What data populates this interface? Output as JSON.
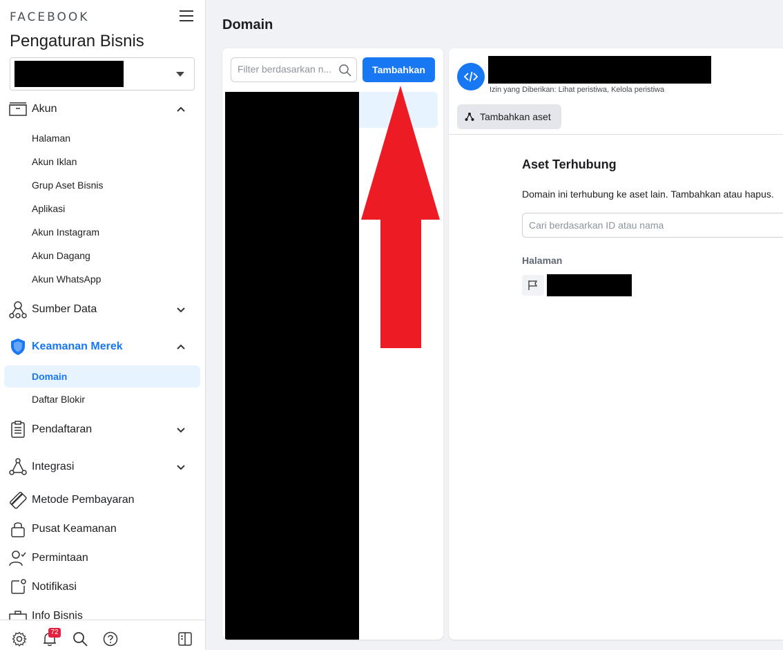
{
  "sidebar": {
    "brand": "FACEBOOK",
    "title": "Pengaturan Bisnis",
    "groups": {
      "akun": "Akun",
      "sumber_data": "Sumber Data",
      "keamanan": "Keamanan Merek",
      "pendaftaran": "Pendaftaran",
      "integrasi": "Integrasi",
      "pembayaran": "Metode Pembayaran",
      "pusat": "Pusat Keamanan",
      "permintaan": "Permintaan",
      "notifikasi": "Notifikasi",
      "info": "Info Bisnis"
    },
    "akun_items": [
      "Halaman",
      "Akun Iklan",
      "Grup Aset Bisnis",
      "Aplikasi",
      "Akun Instagram",
      "Akun Dagang",
      "Akun WhatsApp"
    ],
    "keamanan_items": [
      "Domain",
      "Daftar Blokir"
    ],
    "notif_count": "72"
  },
  "main": {
    "title": "Domain",
    "filter_placeholder": "Filter berdasarkan n...",
    "add_label": "Tambahkan"
  },
  "detail": {
    "permissions": "Izin yang Diberikan: Lihat peristiwa, Kelola peristiwa",
    "add_asset": "Tambahkan aset",
    "section_title": "Aset Terhubung",
    "section_desc": "Domain ini terhubung ke aset lain. Tambahkan atau hapus.",
    "search_placeholder": "Cari berdasarkan ID atau nama",
    "pages_heading": "Halaman"
  },
  "colors": {
    "accent": "#1877f2",
    "arrow": "#ed1c24",
    "active_bg": "#e7f3ff"
  }
}
